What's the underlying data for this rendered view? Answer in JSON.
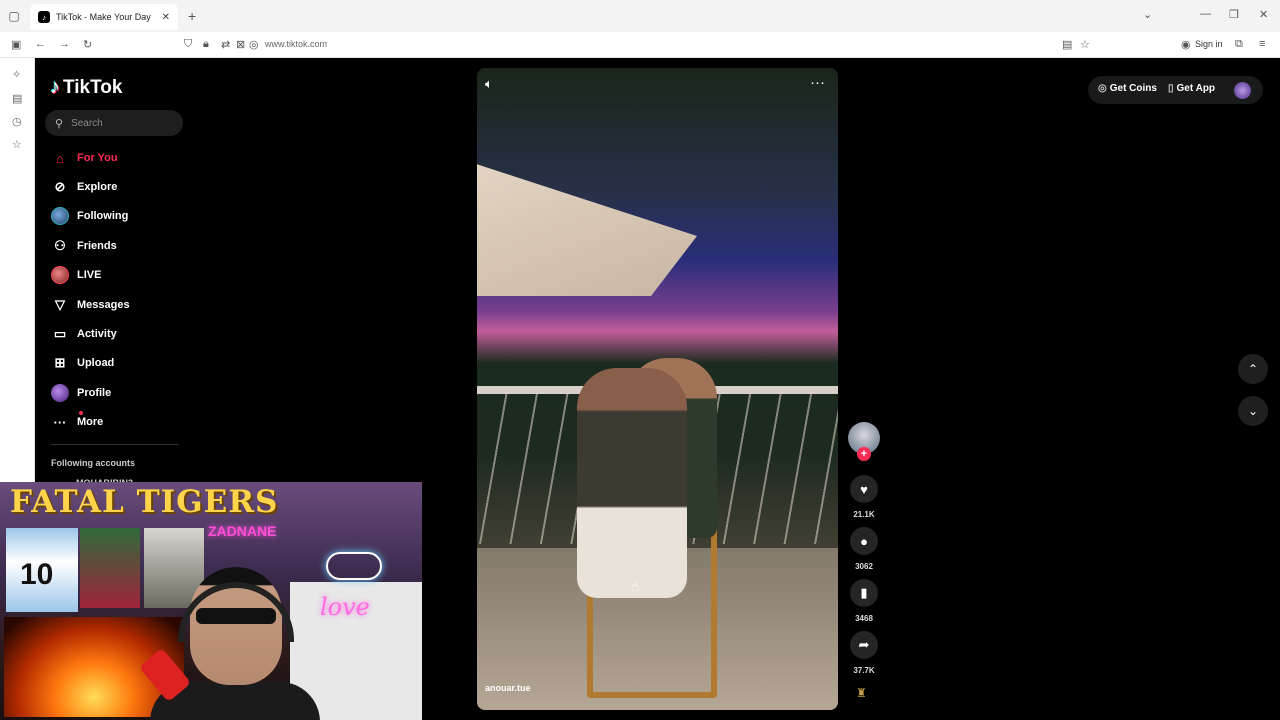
{
  "browser": {
    "tab_title": "TikTok - Make Your Day",
    "url": "www.tiktok.com",
    "sign_in": "Sign in"
  },
  "tiktok": {
    "logo_text": "TikTok",
    "search_placeholder": "Search",
    "nav": [
      {
        "label": "For You",
        "icon": "home-icon"
      },
      {
        "label": "Explore",
        "icon": "compass-icon"
      },
      {
        "label": "Following",
        "icon": "following-avatar-icon"
      },
      {
        "label": "Friends",
        "icon": "friends-icon"
      },
      {
        "label": "LIVE",
        "icon": "live-avatar-icon"
      },
      {
        "label": "Messages",
        "icon": "messages-icon"
      },
      {
        "label": "Activity",
        "icon": "activity-icon"
      },
      {
        "label": "Upload",
        "icon": "upload-icon"
      },
      {
        "label": "Profile",
        "icon": "profile-avatar-icon"
      },
      {
        "label": "More",
        "icon": "more-icon"
      }
    ],
    "following_header": "Following accounts",
    "following_first": "MOHABIBIN3"
  },
  "video": {
    "username": "anouar.tue",
    "likes": "21.1K",
    "comments": "3062",
    "saves": "3468",
    "shares": "37.7K"
  },
  "topright": {
    "get_coins": "Get Coins",
    "get_app": "Get App"
  },
  "webcam": {
    "banner": "FATAL TIGERS",
    "neon_name": "ZADNANE",
    "love_sign": "love",
    "jersey_number": "10"
  },
  "colors": {
    "accent": "#fe2c55",
    "background": "#000000"
  }
}
